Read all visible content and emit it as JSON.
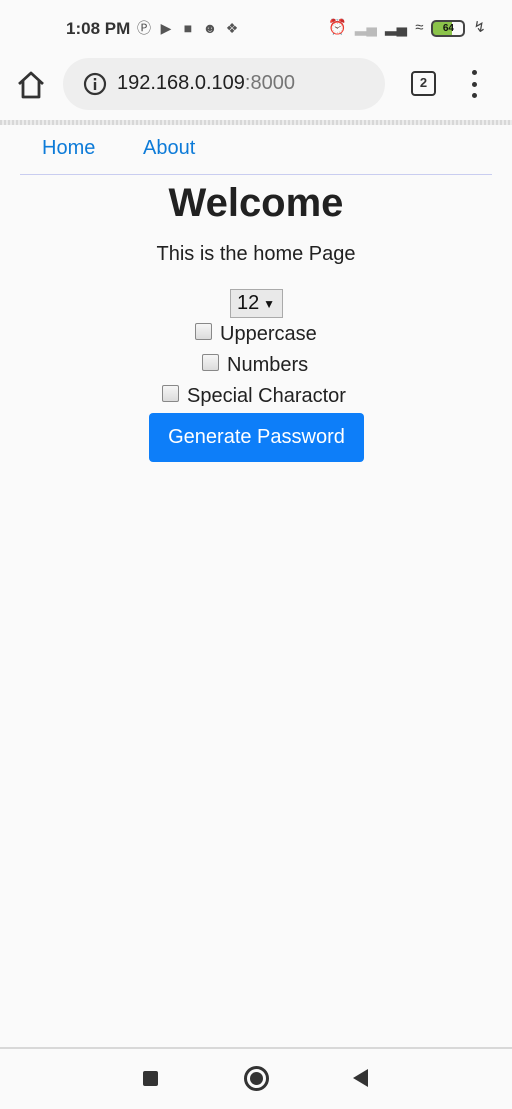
{
  "status_bar": {
    "time": "1:08 PM",
    "left_icons": [
      "pinterest-icon",
      "youtube-icon",
      "video-camera-icon",
      "panda-icon",
      "app-icon"
    ],
    "right_icons": [
      "alarm-icon",
      "signal-weak-icon",
      "signal-icon",
      "wifi-icon"
    ],
    "battery": "64",
    "charging_icon": "lightning-icon"
  },
  "browser": {
    "url_host": "192.168.0.109",
    "url_port": ":8000",
    "tab_count": "2"
  },
  "nav": {
    "home_label": "Home",
    "about_label": "About"
  },
  "main": {
    "title": "Welcome",
    "subtitle": "This is the home Page",
    "length_value": "12",
    "checkboxes": [
      {
        "label": "Uppercase",
        "checked": false
      },
      {
        "label": "Numbers",
        "checked": false
      },
      {
        "label": "Special Charactor",
        "checked": false
      }
    ],
    "generate_label": "Generate Password"
  },
  "colors": {
    "link": "#0d7bd8",
    "button": "#0d7ef9"
  }
}
